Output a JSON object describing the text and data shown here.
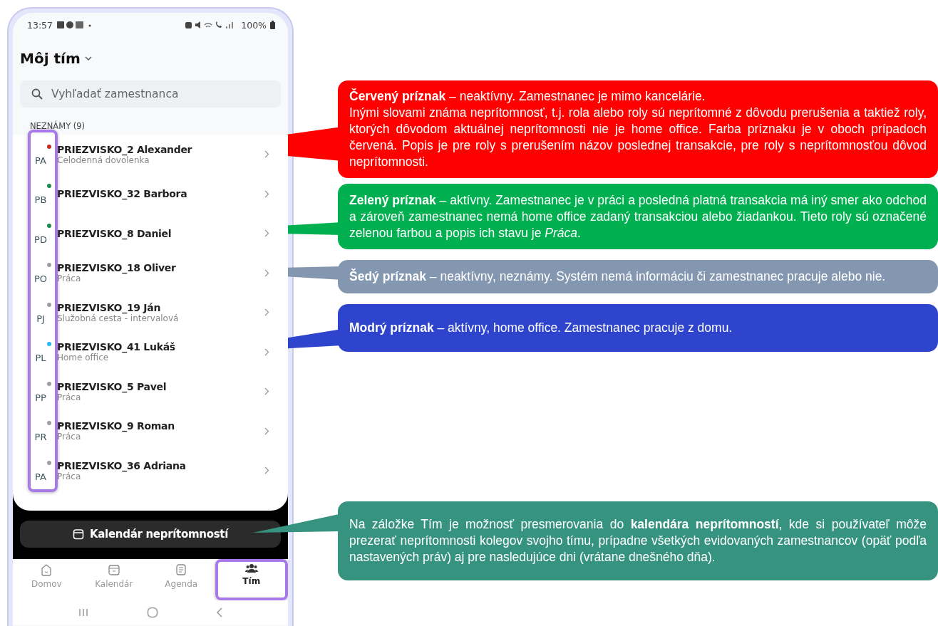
{
  "status_bar": {
    "time": "13:57",
    "battery": "100%"
  },
  "header": {
    "title": "Môj tím"
  },
  "search": {
    "placeholder": "Vyhľadať zamestnanca"
  },
  "group": {
    "label": "NEZNÁMY (9)",
    "avatars_highlighted": true
  },
  "employees": [
    {
      "initials": "PA",
      "name": "PRIEZVISKO_2 Alexander",
      "status": "Celodenná dovolenka",
      "color": "#c62828"
    },
    {
      "initials": "PB",
      "name": "PRIEZVISKO_32 Barbora",
      "color": "#1b8a4b"
    },
    {
      "initials": "PD",
      "name": "PRIEZVISKO_8 Daniel",
      "color": "#1b8a4b"
    },
    {
      "initials": "PO",
      "name": "PRIEZVISKO_18 Oliver",
      "status": "Práca",
      "color": "#9e9e9e"
    },
    {
      "initials": "PJ",
      "name": "PRIEZVISKO_19 Ján",
      "status": "Služobná cesta - intervalová",
      "color": "#9e9e9e"
    },
    {
      "initials": "PL",
      "name": "PRIEZVISKO_41 Lukáš",
      "status": "Home office",
      "color": "#29b6f6"
    },
    {
      "initials": "PP",
      "name": "PRIEZVISKO_5 Pavel",
      "status": "Práca",
      "color": "#9e9e9e"
    },
    {
      "initials": "PR",
      "name": "PRIEZVISKO_9 Roman",
      "status": "Práca",
      "color": "#9e9e9e"
    },
    {
      "initials": "PA",
      "name": "PRIEZVISKO_36 Adriana",
      "status": "Práca",
      "color": "#9e9e9e"
    }
  ],
  "calendar_button": {
    "label": "Kalendár neprítomností"
  },
  "nav": [
    {
      "label": "Domov",
      "kind": "home",
      "selected": false,
      "highlighted": false
    },
    {
      "label": "Kalendár",
      "kind": "calendar",
      "selected": false,
      "highlighted": false
    },
    {
      "label": "Agenda",
      "kind": "agenda",
      "selected": false,
      "highlighted": false
    },
    {
      "label": "Tím",
      "kind": "team",
      "selected": true,
      "highlighted": true
    }
  ],
  "callouts": [
    {
      "color": "#ff0000",
      "paragraphs": [
        "**Červený príznak** – neaktívny. Zamestnanec je mimo kancelárie.",
        "Inými slovami známa neprítomnosť, t.j. rola alebo roly sú neprítomné z dôvodu prerušenia a taktiež roly, ktorých dôvodom aktuálnej neprítomnosti nie je home office. Farba príznaku je v oboch prípadoch červená. Popis je pre roly s prerušením názov poslednej transakcie, pre roly s neprítomnosťou dôvod neprítomnosti."
      ]
    },
    {
      "color": "#00b050",
      "paragraphs": [
        "**Zelený príznak** – aktívny. Zamestnanec je v práci a posledná platná transakcia má iný smer ako odchod a zároveň zamestnanec nemá home office zadaný transakciou alebo žiadankou. Tieto roly sú označené zelenou farbou a popis ich stavu je *Práca*."
      ]
    },
    {
      "color": "#8497b0",
      "paragraphs": [
        "**Šedý príznak** – neaktívny, neznámy. Systém nemá informáciu či zamestnanec pracuje alebo nie."
      ]
    },
    {
      "color": "#2e44cc",
      "paragraphs": [
        "**Modrý príznak** – aktívny, home office. Zamestnanec pracuje z domu."
      ]
    },
    {
      "color": "#36937f",
      "paragraphs": [
        "Na záložke Tím je možnosť presmerovania do **kalendára neprítomností**, kde si používateľ môže prezerať neprítomnosti kolegov svojho tímu, prípadne všetkých evidovaných zamestnancov (opäť podľa nastavených práv) aj pre nasledujúce dni (vrátane dnešného dňa)."
      ]
    }
  ]
}
